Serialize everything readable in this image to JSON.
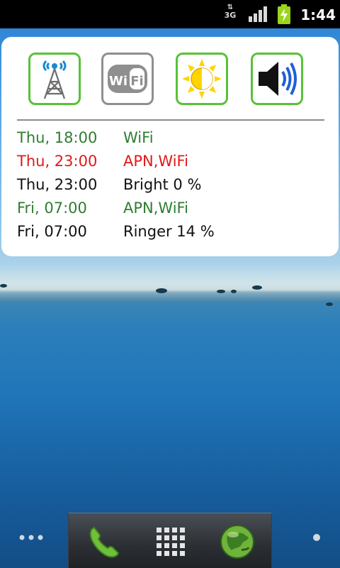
{
  "status_bar": {
    "network_type": "3G",
    "time": "1:44",
    "icons": [
      "data-arrows-icon",
      "signal-bars-icon",
      "battery-charging-icon"
    ]
  },
  "widget": {
    "toggles": [
      {
        "name": "mobile-data",
        "icon": "cell-tower-icon",
        "state": "on"
      },
      {
        "name": "wifi",
        "icon": "wifi-icon",
        "state": "off",
        "label": "Wi Fi"
      },
      {
        "name": "brightness",
        "icon": "sun-icon",
        "state": "on"
      },
      {
        "name": "volume",
        "icon": "speaker-icon",
        "state": "on"
      }
    ],
    "schedule": [
      {
        "time": "Thu, 18:00",
        "action": "WiFi",
        "color": "#2e7d32"
      },
      {
        "time": "Thu, 23:00",
        "action": "APN,WiFi",
        "color": "#e01919"
      },
      {
        "time": "Thu, 23:00",
        "action": "Bright 0 %",
        "color": "#111111"
      },
      {
        "time": "Fri, 07:00",
        "action": "APN,WiFi",
        "color": "#2e7d32"
      },
      {
        "time": "Fri, 07:00",
        "action": "Ringer 14 %",
        "color": "#111111"
      }
    ]
  },
  "dock": {
    "buttons": [
      "phone-icon",
      "app-drawer-icon",
      "browser-globe-icon"
    ]
  },
  "colors": {
    "toggle_on": "#58c237",
    "toggle_off": "#8f8f8f",
    "enabled_text": "#2e7d32",
    "disabled_text": "#e01919"
  }
}
